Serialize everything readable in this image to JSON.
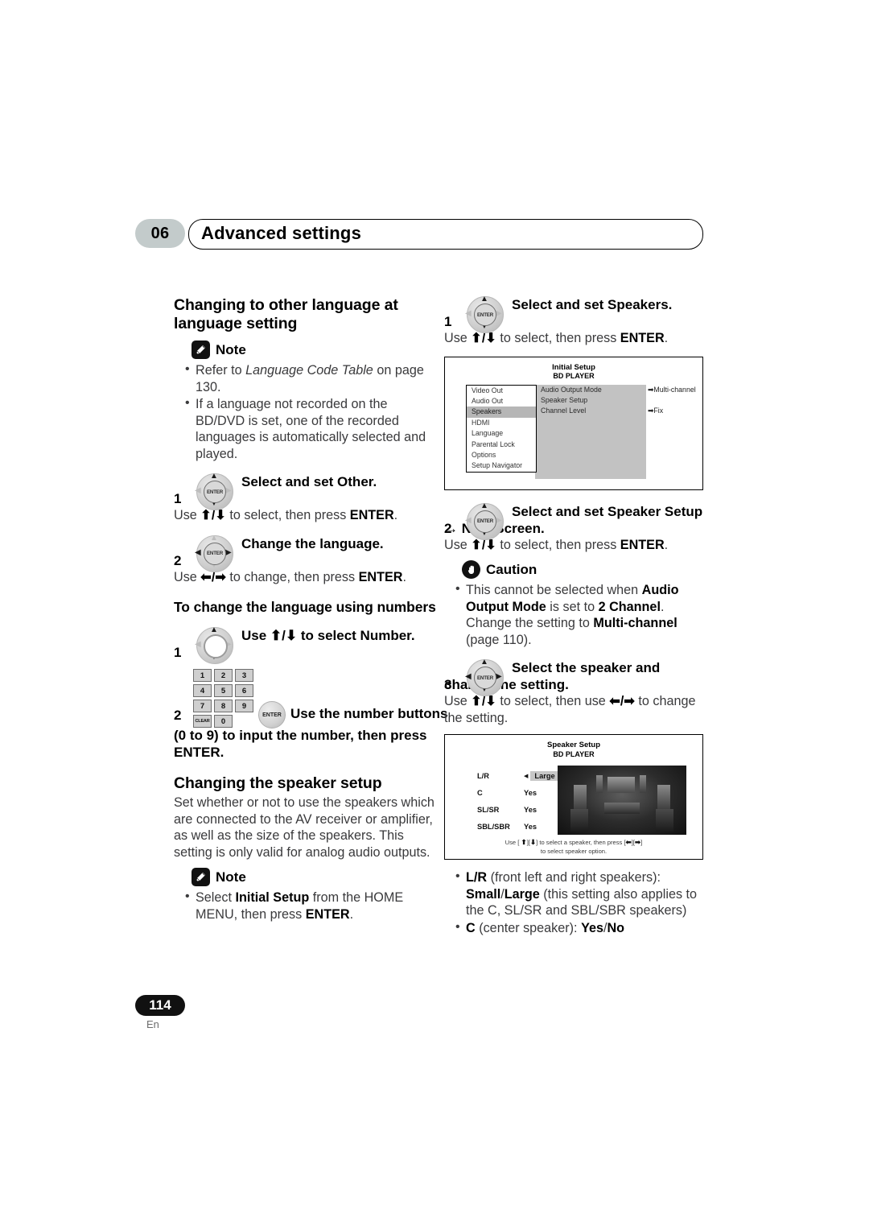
{
  "runhead": {
    "chapter_number": "06",
    "chapter_title": "Advanced settings"
  },
  "left_column": {
    "heading": "Changing to other language at language setting",
    "note_label": "Note",
    "note_bullets": [
      {
        "pre": "Refer to ",
        "em": "Language Code Table",
        "post": " on page 130."
      },
      {
        "pre": "If a language not recorded on the BD/DVD is set, one of the recorded languages is automatically selected and played.",
        "em": "",
        "post": ""
      }
    ],
    "step1": {
      "number": "1",
      "title": "Select and set Other.",
      "body_pre": "Use ",
      "body_arrows": "⬆/⬇",
      "body_mid": " to select, then press ",
      "body_bold": "ENTER",
      "body_post": "."
    },
    "step2": {
      "number": "2",
      "title": "Change the language.",
      "body_pre": "Use ",
      "body_arrows": "⬅/➡",
      "body_mid": " to change, then press ",
      "body_bold": "ENTER",
      "body_post": "."
    },
    "subheading": "To change the language using numbers",
    "num_step1": {
      "number": "1",
      "title_pre": "Use ",
      "title_arrows": "⬆/⬇",
      "title_post": " to select Number."
    },
    "num_step2": {
      "number": "2",
      "keys": [
        [
          "1",
          "2",
          "3"
        ],
        [
          "4",
          "5",
          "6"
        ],
        [
          "7",
          "8",
          "9"
        ],
        [
          "CLEAR",
          "0"
        ]
      ],
      "enter_label": "ENTER",
      "title": "Use the number buttons",
      "continuation": "(0 to 9) to input the number, then press ENTER."
    },
    "heading2": "Changing the speaker setup",
    "body2": "Set whether or not to use the speakers which are connected to the AV receiver or amplifier, as well as the size of the speakers. This setting is only valid for analog audio outputs.",
    "note2_label": "Note",
    "note2_bullet": {
      "pre": "Select ",
      "b1": "Initial Setup",
      "mid": " from the HOME MENU, then press ",
      "b2": "ENTER",
      "post": "."
    }
  },
  "right_column": {
    "step1": {
      "number": "1",
      "title": "Select and set Speakers.",
      "body_pre": "Use ",
      "body_arrows": "⬆/⬇",
      "body_mid": " to select, then press ",
      "body_bold": "ENTER",
      "body_post": "."
    },
    "initial_setup_screen": {
      "title": "Initial Setup",
      "subtitle": "BD PLAYER",
      "menu_items": [
        {
          "label": "Video Out",
          "selected": false
        },
        {
          "label": "Audio Out",
          "selected": false
        },
        {
          "label": "Speakers",
          "selected": true
        },
        {
          "label": "HDMI",
          "selected": false
        },
        {
          "label": "Language",
          "selected": false
        },
        {
          "label": "Parental Lock",
          "selected": false
        },
        {
          "label": "Options",
          "selected": false
        },
        {
          "label": "Setup Navigator",
          "selected": false
        }
      ],
      "options": [
        {
          "label": "Audio Output Mode",
          "value": "Multi-channel"
        },
        {
          "label": "Speaker Setup",
          "value": ""
        },
        {
          "label": "Channel Level",
          "value": "Fix"
        }
      ]
    },
    "step2": {
      "number": "2",
      "title": "Select and set Speaker Setup → Next Screen.",
      "body_pre": "Use ",
      "body_arrows": "⬆/⬇",
      "body_mid": " to select, then press ",
      "body_bold": "ENTER",
      "body_post": "."
    },
    "caution_label": "Caution",
    "caution_bullet": {
      "pre": "This cannot be selected when ",
      "b1": "Audio Output Mode",
      "mid1": " is set to ",
      "b2": "2 Channel",
      "mid2": ". Change the setting to ",
      "b3": "Multi-channel",
      "post": " (page 110)."
    },
    "step3": {
      "number": "3",
      "title": "Select the speaker and change the setting.",
      "body_pre": "Use ",
      "body_arrows1": "⬆/⬇",
      "body_mid": " to select, then use ",
      "body_arrows2": "⬅/➡",
      "body_post": " to change the setting."
    },
    "speaker_setup_screen": {
      "title": "Speaker Setup",
      "subtitle": "BD PLAYER",
      "rows": [
        {
          "label": "L/R",
          "value": "Large",
          "highlighted": true
        },
        {
          "label": "C",
          "value": "Yes",
          "highlighted": false
        },
        {
          "label": "SL/SR",
          "value": "Yes",
          "highlighted": false
        },
        {
          "label": "SBL/SBR",
          "value": "Yes",
          "highlighted": false
        }
      ],
      "help_pre": "Use [",
      "help_up": "⬆",
      "help_mid1": "][",
      "help_down": "⬇",
      "help_mid2": "] to select a speaker, then press [",
      "help_left": "⬅",
      "help_mid3": "][",
      "help_right": "➡",
      "help_post": "]",
      "help_line2": "to select speaker option."
    },
    "bullets": [
      {
        "b1": "L/R",
        "t1": " (front left and right speakers): ",
        "b2": "Small",
        "t2": "/",
        "b3": "Large",
        "t3": " (this setting also applies to the C, SL/SR and SBL/SBR speakers)"
      },
      {
        "b1": "C",
        "t1": " (center speaker): ",
        "b2": "Yes",
        "t2": "/",
        "b3": "No",
        "t3": ""
      }
    ]
  },
  "folio": {
    "page_number": "114",
    "language_code": "En"
  }
}
